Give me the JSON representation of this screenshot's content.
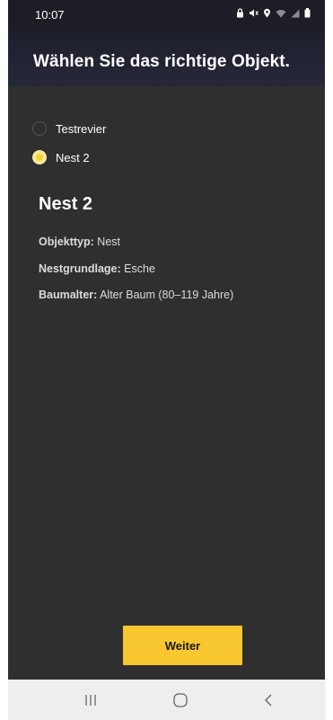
{
  "status_bar": {
    "time": "10:07",
    "icons": [
      "lock-icon",
      "mute-icon",
      "location-icon",
      "wifi-icon",
      "signal-icon",
      "battery-icon"
    ]
  },
  "header": {
    "title": "Wählen Sie das richtige Objekt."
  },
  "options": [
    {
      "label": "Testrevier",
      "selected": false
    },
    {
      "label": "Nest 2",
      "selected": true
    }
  ],
  "detail": {
    "title": "Nest 2",
    "fields": [
      {
        "key": "Objekttyp:",
        "value": "Nest"
      },
      {
        "key": "Nestgrundlage:",
        "value": "Esche"
      },
      {
        "key": "Baumalter:",
        "value": "Alter Baum (80–119 Jahre)"
      }
    ]
  },
  "actions": {
    "next_label": "Weiter"
  },
  "nav": {
    "icons": [
      "recent-apps-icon",
      "home-icon",
      "back-icon"
    ]
  },
  "colors": {
    "accent": "#f9c72f",
    "background": "#2f2f2f",
    "header": "#1d1f2c"
  }
}
